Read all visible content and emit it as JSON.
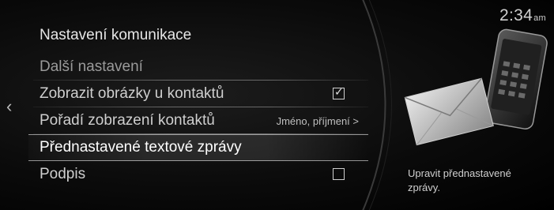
{
  "clock": {
    "time": "2:34",
    "ampm": "am"
  },
  "menu": {
    "title": "Nastavení komunikace",
    "rows": [
      {
        "label": "Další nastavení"
      },
      {
        "label": "Zobrazit obrázky u kontaktů",
        "checked": true
      },
      {
        "label": "Pořadí zobrazení kontaktů",
        "value": "Jméno, příjmení >"
      },
      {
        "label": "Přednastavené textové zprávy"
      },
      {
        "label": "Podpis",
        "checked": false
      }
    ]
  },
  "hint": "Upravit přednastavené zprávy.",
  "icons": {
    "back": "chevron-left-icon",
    "illustration": "envelope-phone-icon"
  }
}
